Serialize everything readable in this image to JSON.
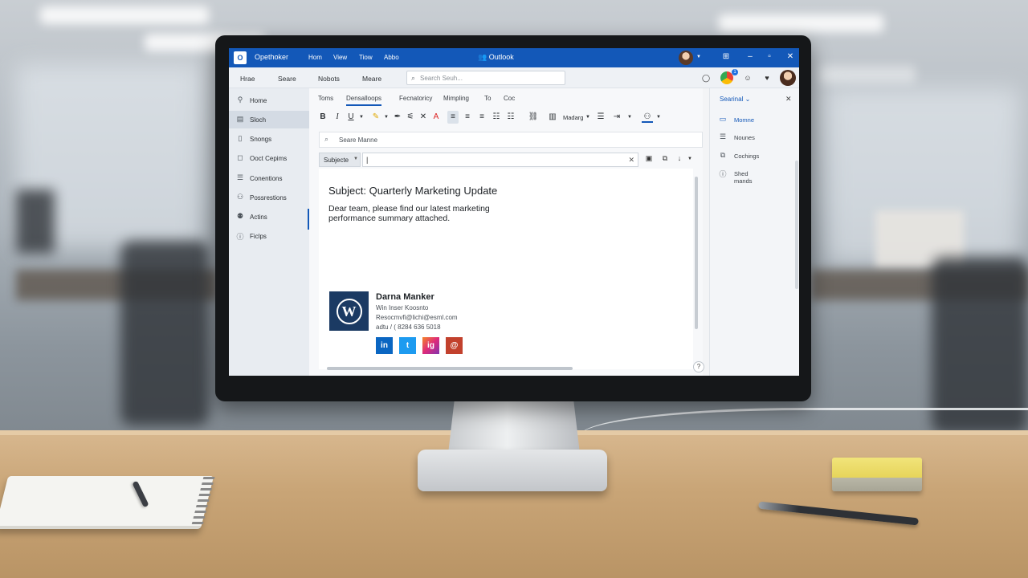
{
  "titlebar": {
    "app_name": "Opethoker",
    "menu": [
      "Hom",
      "View",
      "Tiow",
      "Abbo"
    ],
    "center_title": "Outlook"
  },
  "navbar": {
    "items": [
      "Hrae",
      "Seare",
      "Nobots",
      "Meare"
    ],
    "search_placeholder": "Search Seuh..."
  },
  "sidebar": {
    "items": [
      {
        "label": "Home",
        "icon": "pin-icon"
      },
      {
        "label": "Sloch",
        "icon": "card-icon",
        "active": true
      },
      {
        "label": "Snongs",
        "icon": "doc-icon"
      },
      {
        "label": "Ooct Cepims",
        "icon": "chat-icon"
      },
      {
        "label": "Conentions",
        "icon": "list-icon"
      },
      {
        "label": "Possrestions",
        "icon": "person-icon"
      },
      {
        "label": "Actins",
        "icon": "people-icon"
      },
      {
        "label": "Ficlps",
        "icon": "info-icon"
      }
    ]
  },
  "compose": {
    "tabs": [
      "Toms",
      "Densalloops",
      "Fecnatoricy",
      "Mimpling",
      "To",
      "Coc"
    ],
    "active_tab": 1,
    "format_label": "Madarg",
    "to_placeholder": "Seare Manne",
    "subject_label": "Subjecte",
    "subject_cursor": "|",
    "message": {
      "subject": "Subject: Quarterly Marketing Update",
      "body": "Dear team, please find our latest marketing performance summary attached."
    },
    "signature": {
      "logo_letter": "W",
      "name": "Darna Manker",
      "title": "Win Inser Koosnto",
      "email": "Resocmvfi@lichi@esml.com",
      "phone": "adtu / ( 8284 636 5018",
      "social": [
        "in",
        "t",
        "ig",
        "@"
      ]
    }
  },
  "rightpane": {
    "header": "Searinal",
    "items": [
      {
        "label": "Momne",
        "icon": "monitor-icon",
        "active": true
      },
      {
        "label": "Nounes",
        "icon": "list-icon"
      },
      {
        "label": "Cochings",
        "icon": "copy-icon"
      },
      {
        "label": "Shed mands",
        "icon": "info-icon"
      }
    ]
  },
  "colors": {
    "accent": "#1358b8",
    "linkedin": "#0a66c2",
    "twitter": "#1d9bf0",
    "signature_logo": "#1b3a63"
  }
}
